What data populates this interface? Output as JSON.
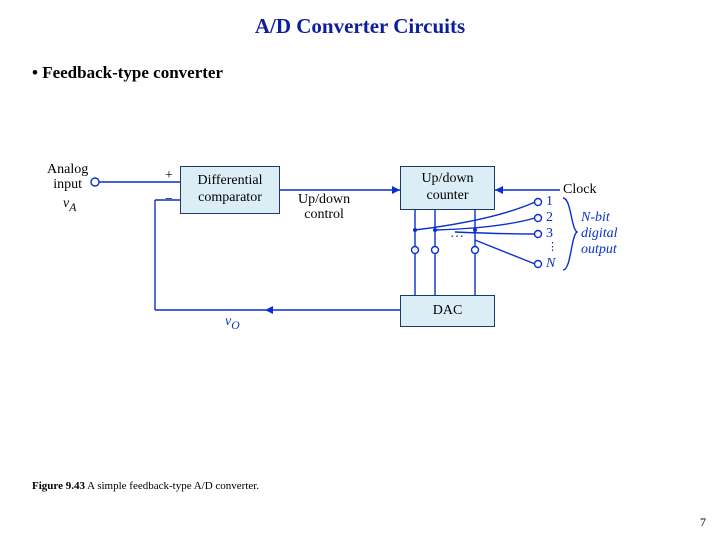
{
  "title": "A/D Converter Circuits",
  "bullet": "• Feedback-type converter",
  "diagram": {
    "analog_input": "Analog\ninput",
    "vA": "v",
    "vA_sub": "A",
    "plus": "+",
    "minus": "−",
    "comp": "Differential\ncomparator",
    "updown_control": "Up/down\ncontrol",
    "counter": "Up/down\ncounter",
    "clock": "Clock",
    "dac": "DAC",
    "vO": "v",
    "vO_sub": "O",
    "out1": "1",
    "out2": "2",
    "out3": "3",
    "outN": "N",
    "outdots": "⋮",
    "digital_output": "N-bit\ndigital\noutput"
  },
  "caption_fig": "Figure 9.43",
  "caption_txt": " A simple feedback-type A/D converter.",
  "pagenum": "7"
}
